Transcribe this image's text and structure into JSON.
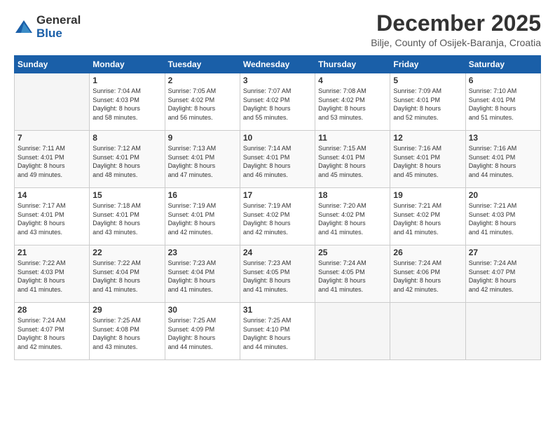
{
  "logo": {
    "general": "General",
    "blue": "Blue"
  },
  "header": {
    "month": "December 2025",
    "location": "Bilje, County of Osijek-Baranja, Croatia"
  },
  "weekdays": [
    "Sunday",
    "Monday",
    "Tuesday",
    "Wednesday",
    "Thursday",
    "Friday",
    "Saturday"
  ],
  "weeks": [
    [
      {
        "day": "",
        "detail": ""
      },
      {
        "day": "1",
        "detail": "Sunrise: 7:04 AM\nSunset: 4:03 PM\nDaylight: 8 hours\nand 58 minutes."
      },
      {
        "day": "2",
        "detail": "Sunrise: 7:05 AM\nSunset: 4:02 PM\nDaylight: 8 hours\nand 56 minutes."
      },
      {
        "day": "3",
        "detail": "Sunrise: 7:07 AM\nSunset: 4:02 PM\nDaylight: 8 hours\nand 55 minutes."
      },
      {
        "day": "4",
        "detail": "Sunrise: 7:08 AM\nSunset: 4:02 PM\nDaylight: 8 hours\nand 53 minutes."
      },
      {
        "day": "5",
        "detail": "Sunrise: 7:09 AM\nSunset: 4:01 PM\nDaylight: 8 hours\nand 52 minutes."
      },
      {
        "day": "6",
        "detail": "Sunrise: 7:10 AM\nSunset: 4:01 PM\nDaylight: 8 hours\nand 51 minutes."
      }
    ],
    [
      {
        "day": "7",
        "detail": "Sunrise: 7:11 AM\nSunset: 4:01 PM\nDaylight: 8 hours\nand 49 minutes."
      },
      {
        "day": "8",
        "detail": "Sunrise: 7:12 AM\nSunset: 4:01 PM\nDaylight: 8 hours\nand 48 minutes."
      },
      {
        "day": "9",
        "detail": "Sunrise: 7:13 AM\nSunset: 4:01 PM\nDaylight: 8 hours\nand 47 minutes."
      },
      {
        "day": "10",
        "detail": "Sunrise: 7:14 AM\nSunset: 4:01 PM\nDaylight: 8 hours\nand 46 minutes."
      },
      {
        "day": "11",
        "detail": "Sunrise: 7:15 AM\nSunset: 4:01 PM\nDaylight: 8 hours\nand 45 minutes."
      },
      {
        "day": "12",
        "detail": "Sunrise: 7:16 AM\nSunset: 4:01 PM\nDaylight: 8 hours\nand 45 minutes."
      },
      {
        "day": "13",
        "detail": "Sunrise: 7:16 AM\nSunset: 4:01 PM\nDaylight: 8 hours\nand 44 minutes."
      }
    ],
    [
      {
        "day": "14",
        "detail": "Sunrise: 7:17 AM\nSunset: 4:01 PM\nDaylight: 8 hours\nand 43 minutes."
      },
      {
        "day": "15",
        "detail": "Sunrise: 7:18 AM\nSunset: 4:01 PM\nDaylight: 8 hours\nand 43 minutes."
      },
      {
        "day": "16",
        "detail": "Sunrise: 7:19 AM\nSunset: 4:01 PM\nDaylight: 8 hours\nand 42 minutes."
      },
      {
        "day": "17",
        "detail": "Sunrise: 7:19 AM\nSunset: 4:02 PM\nDaylight: 8 hours\nand 42 minutes."
      },
      {
        "day": "18",
        "detail": "Sunrise: 7:20 AM\nSunset: 4:02 PM\nDaylight: 8 hours\nand 41 minutes."
      },
      {
        "day": "19",
        "detail": "Sunrise: 7:21 AM\nSunset: 4:02 PM\nDaylight: 8 hours\nand 41 minutes."
      },
      {
        "day": "20",
        "detail": "Sunrise: 7:21 AM\nSunset: 4:03 PM\nDaylight: 8 hours\nand 41 minutes."
      }
    ],
    [
      {
        "day": "21",
        "detail": "Sunrise: 7:22 AM\nSunset: 4:03 PM\nDaylight: 8 hours\nand 41 minutes."
      },
      {
        "day": "22",
        "detail": "Sunrise: 7:22 AM\nSunset: 4:04 PM\nDaylight: 8 hours\nand 41 minutes."
      },
      {
        "day": "23",
        "detail": "Sunrise: 7:23 AM\nSunset: 4:04 PM\nDaylight: 8 hours\nand 41 minutes."
      },
      {
        "day": "24",
        "detail": "Sunrise: 7:23 AM\nSunset: 4:05 PM\nDaylight: 8 hours\nand 41 minutes."
      },
      {
        "day": "25",
        "detail": "Sunrise: 7:24 AM\nSunset: 4:05 PM\nDaylight: 8 hours\nand 41 minutes."
      },
      {
        "day": "26",
        "detail": "Sunrise: 7:24 AM\nSunset: 4:06 PM\nDaylight: 8 hours\nand 42 minutes."
      },
      {
        "day": "27",
        "detail": "Sunrise: 7:24 AM\nSunset: 4:07 PM\nDaylight: 8 hours\nand 42 minutes."
      }
    ],
    [
      {
        "day": "28",
        "detail": "Sunrise: 7:24 AM\nSunset: 4:07 PM\nDaylight: 8 hours\nand 42 minutes."
      },
      {
        "day": "29",
        "detail": "Sunrise: 7:25 AM\nSunset: 4:08 PM\nDaylight: 8 hours\nand 43 minutes."
      },
      {
        "day": "30",
        "detail": "Sunrise: 7:25 AM\nSunset: 4:09 PM\nDaylight: 8 hours\nand 44 minutes."
      },
      {
        "day": "31",
        "detail": "Sunrise: 7:25 AM\nSunset: 4:10 PM\nDaylight: 8 hours\nand 44 minutes."
      },
      {
        "day": "",
        "detail": ""
      },
      {
        "day": "",
        "detail": ""
      },
      {
        "day": "",
        "detail": ""
      }
    ]
  ]
}
